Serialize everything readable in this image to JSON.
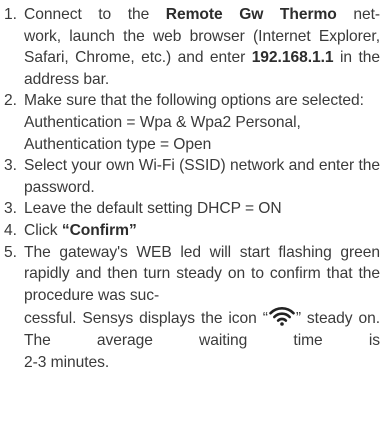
{
  "steps": [
    {
      "num": "1.",
      "t1": "Connect to the ",
      "bold1": "Remote Gw Thermo",
      "t2": " net-",
      "t3": "work, launch the web browser (Internet Explorer, Safari, Chrome, etc.) and enter ",
      "bold2": "192.168.1.1",
      "t4": " in the address bar."
    },
    {
      "num": "2.",
      "t1": "Make sure that the following options are selected:",
      "t2": "Authentication = Wpa & Wpa2 Personal,",
      "t3": "Authentication type = Open"
    },
    {
      "num": "3.",
      "t1": "Select your own Wi-Fi (SSID) network and enter the password."
    },
    {
      "num": "3.",
      "t1": "Leave the default setting DHCP = ON"
    },
    {
      "num": "4.",
      "t1": "Click ",
      "bold1": "“Confirm”"
    },
    {
      "num": "5.",
      "t1": "The gateway's WEB led will start flashing green rapidly and then turn steady on to confirm that the procedure was suc-",
      "t2": "cessful. Sensys displays the icon “",
      "icon": "wifi-icon",
      "t3": "” steady on. The average waiting time is",
      "t4": "2-3 minutes."
    }
  ]
}
